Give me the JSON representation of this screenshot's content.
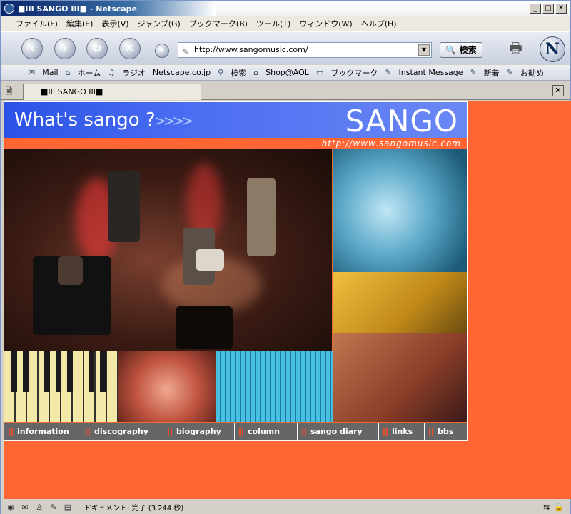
{
  "window": {
    "title": "■III SANGO III■ - Netscape",
    "buttons": {
      "minimize": "_",
      "maximize": "□",
      "close": "✕"
    }
  },
  "menubar": [
    "ファイル(F)",
    "編集(E)",
    "表示(V)",
    "ジャンプ(G)",
    "ブックマーク(B)",
    "ツール(T)",
    "ウィンドウ(W)",
    "ヘルプ(H)"
  ],
  "navbar": {
    "url": "http://www.sangomusic.com/",
    "search_label": "検索",
    "back_glyph": "‹",
    "forward_glyph": "›",
    "reload_glyph": "↻",
    "stop_glyph": "✕",
    "netscape_glyph": "N"
  },
  "personal_toolbar": [
    "Mail",
    "ホーム",
    "ラジオ",
    "Netscape.co.jp",
    "検索",
    "Shop@AOL",
    "ブックマーク",
    "Instant Message",
    "新着",
    "お勧め"
  ],
  "tab": {
    "title": "■III SANGO III■"
  },
  "site": {
    "banner_left": "What's sango ?",
    "banner_arrows": ">>>>",
    "logo": "SANGO",
    "url": "http://www.sangomusic.com",
    "menu": [
      "information",
      "discography",
      "biography",
      "column",
      "sango diary",
      "links",
      "bbs"
    ]
  },
  "status": {
    "text": "ドキュメント: 完了 (3.244 秒)"
  },
  "colors": {
    "accent": "#ff6633",
    "banner": "#3b62ec",
    "menu_bg": "#666666"
  }
}
